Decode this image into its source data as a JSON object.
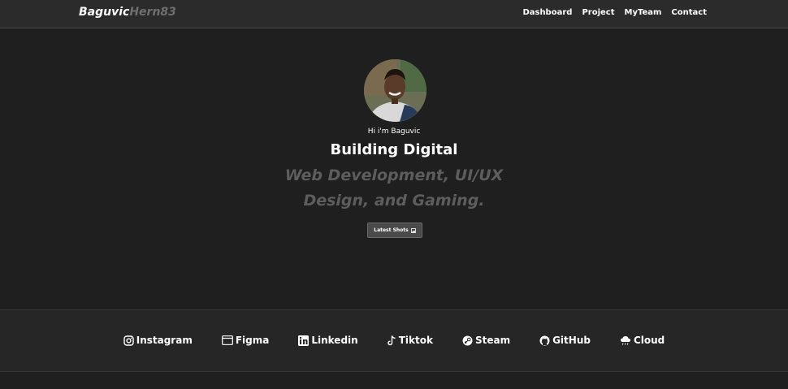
{
  "navbar": {
    "brand_primary": "Baguvic",
    "brand_secondary": "Hern83",
    "links": [
      "Dashboard",
      "Project",
      "MyTeam",
      "Contact"
    ]
  },
  "hero": {
    "greeting": "Hi i'm Baguvic",
    "headline": "Building Digital",
    "subline_1": "Web Development, UI/UX",
    "subline_2": "Design, and Gaming.",
    "button_label": "Latest Shots",
    "button_icon": "picture-icon"
  },
  "social": [
    {
      "label": "Instagram",
      "icon": "instagram-icon"
    },
    {
      "label": "Figma",
      "icon": "window-icon"
    },
    {
      "label": "Linkedin",
      "icon": "linkedin-icon"
    },
    {
      "label": "Tiktok",
      "icon": "tiktok-icon"
    },
    {
      "label": "Steam",
      "icon": "steam-icon"
    },
    {
      "label": "GitHub",
      "icon": "github-icon"
    },
    {
      "label": "Cloud",
      "icon": "cloud-rain-icon"
    }
  ],
  "colors": {
    "background": "#1f1f1f",
    "navbar": "#2b2b2b",
    "muted_text": "#5d5d5d",
    "button": "#4a4a4a"
  }
}
